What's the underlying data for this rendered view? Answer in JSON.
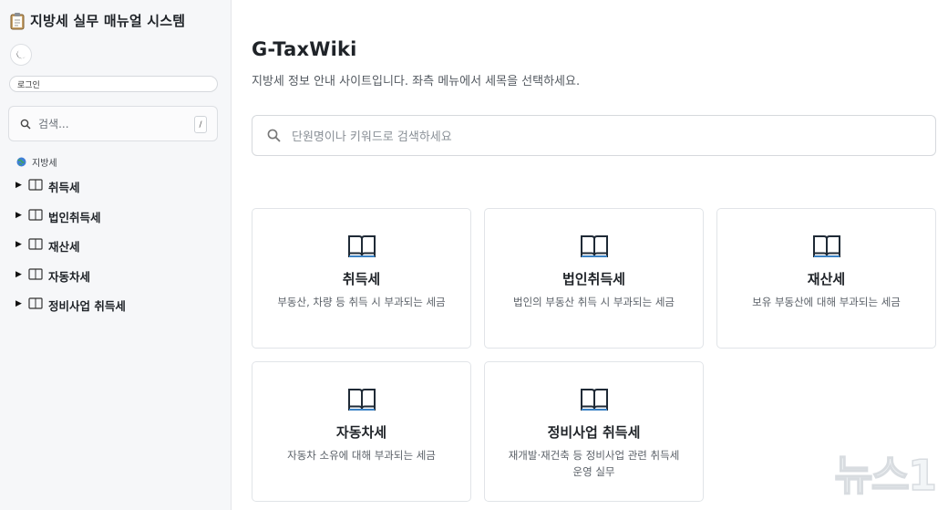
{
  "sidebar": {
    "app_title": "지방세 실무 매뉴얼 시스템",
    "login_label": "로그인",
    "search": {
      "placeholder": "검색...",
      "shortcut": "/"
    },
    "section_label": "지방세",
    "items": [
      {
        "label": "취득세"
      },
      {
        "label": "법인취득세"
      },
      {
        "label": "재산세"
      },
      {
        "label": "자동차세"
      },
      {
        "label": "정비사업 취득세"
      }
    ]
  },
  "main": {
    "title": "G-TaxWiki",
    "subtitle": "지방세 정보 안내 사이트입니다. 좌측 메뉴에서 세목을 선택하세요.",
    "search_placeholder": "단원명이나 키워드로 검색하세요",
    "cards": [
      {
        "title": "취득세",
        "desc": "부동산, 차량 등 취득 시 부과되는 세금"
      },
      {
        "title": "법인취득세",
        "desc": "법인의 부동산 취득 시 부과되는 세금"
      },
      {
        "title": "재산세",
        "desc": "보유 부동산에 대해 부과되는 세금"
      },
      {
        "title": "자동차세",
        "desc": "자동차 소유에 대해 부과되는 세금"
      },
      {
        "title": "정비사업 취득세",
        "desc": "재개발·재건축 등 정비사업 관련 취득세 운영 실무"
      }
    ]
  },
  "watermark": {
    "text": "뉴스1"
  },
  "icons": {
    "app": "clipboard-icon",
    "theme": "moon-icon",
    "search": "search-icon",
    "section": "globe-icon",
    "tree_toggle": "triangle-right-icon",
    "tree_item": "book-outline-icon",
    "card": "open-book-icon"
  },
  "colors": {
    "sidebar_bg": "#f6f7f9",
    "border": "#e1e4e8",
    "text": "#1f2328",
    "muted": "#5b6168"
  }
}
